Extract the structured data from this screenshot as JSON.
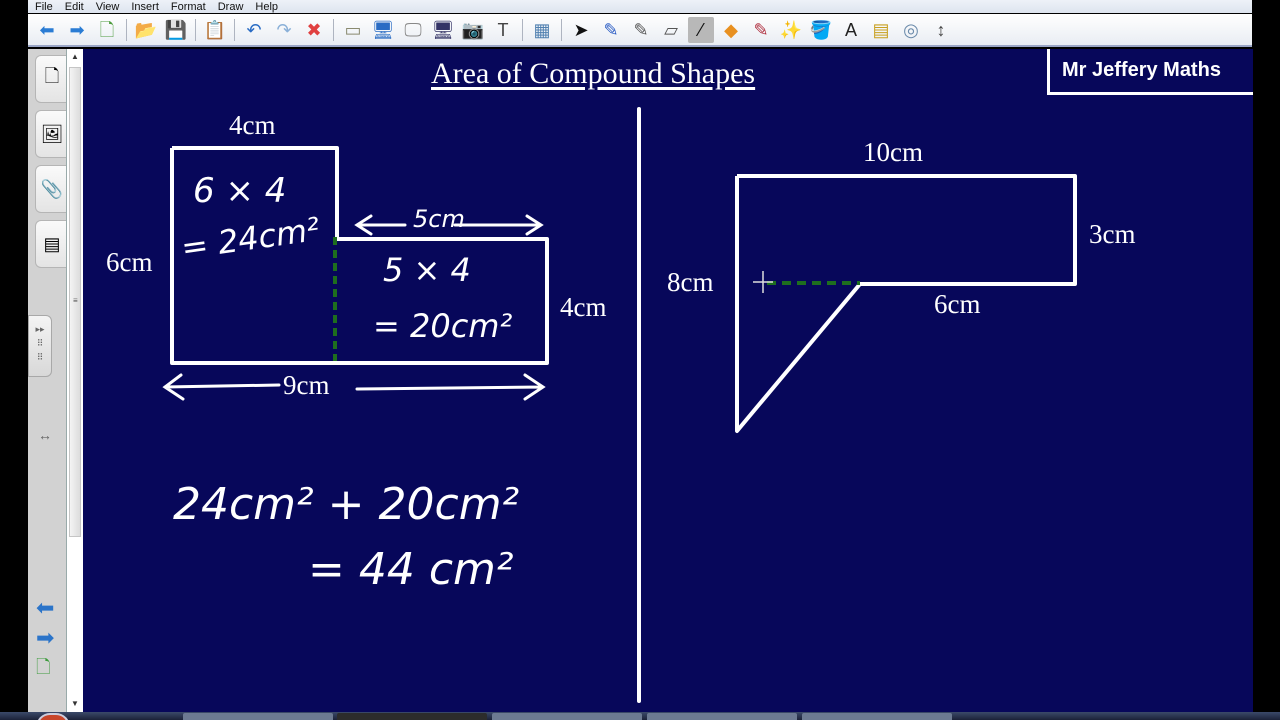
{
  "menubar": {
    "items": [
      "File",
      "Edit",
      "View",
      "Insert",
      "Format",
      "Draw",
      "Help"
    ]
  },
  "toolbar": {
    "buttons": [
      {
        "name": "back-icon",
        "glyph": "⬅",
        "color": "#2a7cd4"
      },
      {
        "name": "forward-icon",
        "glyph": "➡",
        "color": "#2a7cd4"
      },
      {
        "name": "new-page-icon",
        "glyph": "🗋",
        "color": "#4a9a3a"
      },
      {
        "sep": true
      },
      {
        "name": "open-folder-icon",
        "glyph": "📂",
        "color": "#e0b040"
      },
      {
        "name": "save-icon",
        "glyph": "💾",
        "color": "#3050b0"
      },
      {
        "sep": true
      },
      {
        "name": "paste-icon",
        "glyph": "📋",
        "color": "#b08a40"
      },
      {
        "sep": true
      },
      {
        "name": "undo-icon",
        "glyph": "↶",
        "color": "#2a6cc4"
      },
      {
        "name": "redo-icon",
        "glyph": "↷",
        "color": "#8ab0d8"
      },
      {
        "name": "delete-icon",
        "glyph": "✖",
        "color": "#e04040"
      },
      {
        "sep": true
      },
      {
        "name": "screen-shade-icon",
        "glyph": "▭",
        "color": "#8a8a70"
      },
      {
        "name": "full-screen-icon",
        "glyph": "🖥",
        "color": "#2a6cc4"
      },
      {
        "name": "transparent-bg-icon",
        "glyph": "🖵",
        "color": "#888"
      },
      {
        "name": "dual-page-icon",
        "glyph": "🖥",
        "color": "#336"
      },
      {
        "name": "capture-icon",
        "glyph": "📷",
        "color": "#666"
      },
      {
        "name": "document-camera-icon",
        "glyph": "T",
        "color": "#444"
      },
      {
        "sep": true
      },
      {
        "name": "table-icon",
        "glyph": "▦",
        "color": "#5080b0"
      },
      {
        "sep": true
      },
      {
        "name": "select-arrow-icon",
        "glyph": "➤",
        "color": "#111"
      },
      {
        "name": "pen-icon",
        "glyph": "✎",
        "color": "#2a5cc4"
      },
      {
        "name": "creative-pen-icon",
        "glyph": "✎",
        "color": "#555"
      },
      {
        "name": "eraser-icon",
        "glyph": "▱",
        "color": "#555"
      },
      {
        "name": "line-icon",
        "glyph": "⁄",
        "color": "#111",
        "active": true
      },
      {
        "name": "shapes-icon",
        "glyph": "◆",
        "color": "#e89020"
      },
      {
        "name": "shape-recognition-pen-icon",
        "glyph": "✎",
        "color": "#b03040"
      },
      {
        "name": "magic-pen-icon",
        "glyph": "✨",
        "color": "#555"
      },
      {
        "name": "fill-icon",
        "glyph": "🪣",
        "color": "#2a6cc4"
      },
      {
        "name": "text-icon",
        "glyph": "A",
        "color": "#222"
      },
      {
        "name": "properties-icon",
        "glyph": "▤",
        "color": "#c8a020"
      },
      {
        "name": "measurement-tools-icon",
        "glyph": "◎",
        "color": "#6a8aaa"
      },
      {
        "name": "move-toolbar-icon",
        "glyph": "↕",
        "color": "#444"
      }
    ]
  },
  "sidebar": {
    "tabs": [
      {
        "name": "page-sorter-icon",
        "glyph": "🗋"
      },
      {
        "name": "gallery-icon",
        "glyph": "🖼"
      },
      {
        "name": "attachments-icon",
        "glyph": "📎"
      },
      {
        "name": "properties-tab-icon",
        "glyph": "▤"
      }
    ],
    "collapse_glyph": "▸▸",
    "resize_glyph": "↔",
    "nav": {
      "prev": "⬅",
      "next": "➡",
      "add": "🗋"
    }
  },
  "canvas": {
    "title": "Area of Compound Shapes",
    "brand": "Mr Jeffery Maths",
    "shape1": {
      "labels": {
        "top": "4cm",
        "left": "6cm",
        "right": "4cm",
        "step_top": "5cm",
        "bottom": "9cm"
      },
      "work_left": [
        "6 × 4",
        "= 24cm²"
      ],
      "work_right": [
        "5 × 4",
        "= 20cm²"
      ]
    },
    "total": [
      "24cm² + 20cm²",
      "= 44 cm²"
    ],
    "shape2": {
      "labels": {
        "top": "10cm",
        "right": "3cm",
        "left": "8cm",
        "inner": "6cm"
      }
    }
  },
  "colors": {
    "canvas_bg": "#07075a",
    "ink": "#ffffff",
    "guide": "#1e6e1e"
  }
}
